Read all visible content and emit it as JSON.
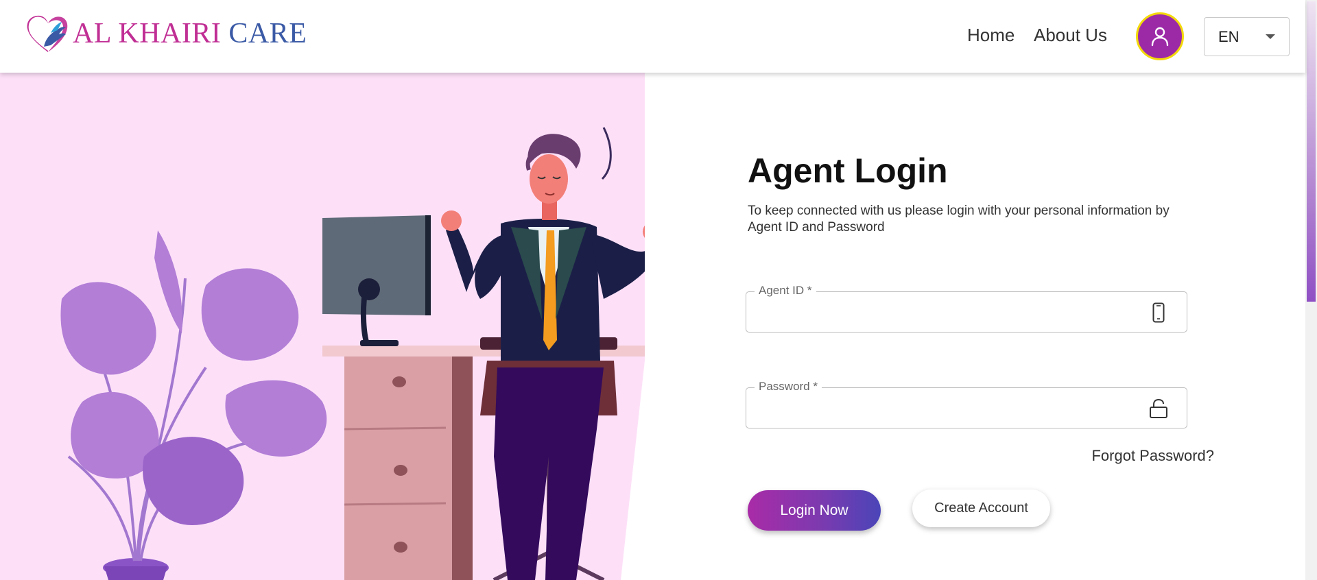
{
  "header": {
    "logo": {
      "text_part1": "AL KHAIRI",
      "text_part2": "CARE",
      "icon": "heart-hands-logo"
    },
    "nav": {
      "home_label": "Home",
      "about_label": "About Us"
    },
    "account_icon": "user-icon",
    "language": {
      "selected": "EN",
      "icon": "chevron-down-icon"
    }
  },
  "hero": {
    "illustration": "man-meditating-at-desk-with-plant"
  },
  "form": {
    "title": "Agent Login",
    "subtitle": "To keep connected with us please login with your personal information by Agent ID and Password",
    "agent_id": {
      "label": "Agent ID *",
      "value": "",
      "icon": "mobile-phone-icon"
    },
    "password": {
      "label": "Password *",
      "value": "",
      "icon": "unlock-icon"
    },
    "forgot_label": "Forgot Password?",
    "login_label": "Login Now",
    "create_label": "Create Account"
  },
  "colors": {
    "brand_magenta": "#c02e94",
    "brand_blue": "#3b5aa6",
    "avatar_bg": "#9c2aa7",
    "avatar_ring": "#f3d90a",
    "hero_bg": "#fde0f8",
    "login_gradient_start": "#a92ba7",
    "login_gradient_end": "#4a45b8"
  }
}
